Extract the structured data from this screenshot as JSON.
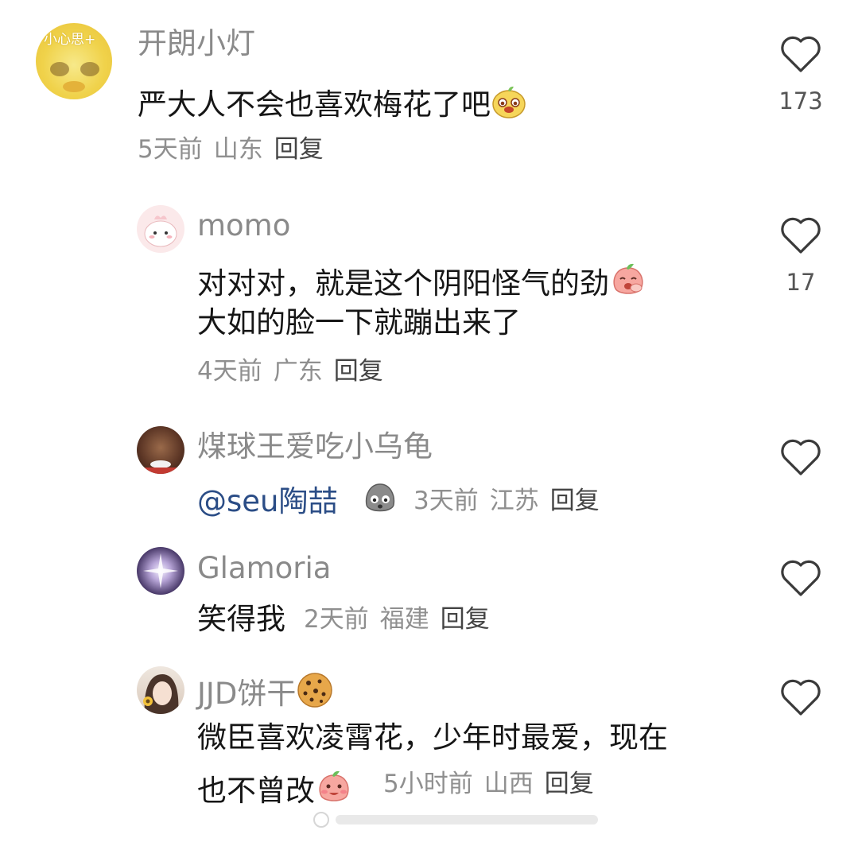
{
  "colors": {
    "name": "#8a8a8a",
    "text": "#161616",
    "meta": "#8f8f8f",
    "mention": "#2b4d86",
    "icon": "#3a3a3a"
  },
  "comments": [
    {
      "username": "开朗小灯",
      "avatar_text": "小心思+",
      "text": "严大人不会也喜欢梅花了吧",
      "emoji": "duck-emoji",
      "time": "5天前",
      "location": "山东",
      "reply": "回复",
      "likes": "173"
    },
    {
      "username": "momo",
      "text_lines": [
        "对对对，就是这个阴阳怪气的劲",
        "大如的脸一下就蹦出来了"
      ],
      "emoji": "peach-emoji",
      "time": "4天前",
      "location": "广东",
      "reply": "回复",
      "likes": "17"
    },
    {
      "username": "煤球王爱吃小乌龟",
      "mention": "@seu陶喆",
      "emoji": "gray-blob-emoji",
      "time": "3天前",
      "location": "江苏",
      "reply": "回复"
    },
    {
      "username": "Glamoria",
      "text": "笑得我",
      "time": "2天前",
      "location": "福建",
      "reply": "回复"
    },
    {
      "username": "JJD饼干",
      "name_emoji": "cookie-emoji",
      "text_lines": [
        "微臣喜欢凌霄花，少年时最爱，现在",
        "也不曾改"
      ],
      "emoji": "peach-emoji",
      "time": "5小时前",
      "location": "山西",
      "reply": "回复"
    }
  ]
}
